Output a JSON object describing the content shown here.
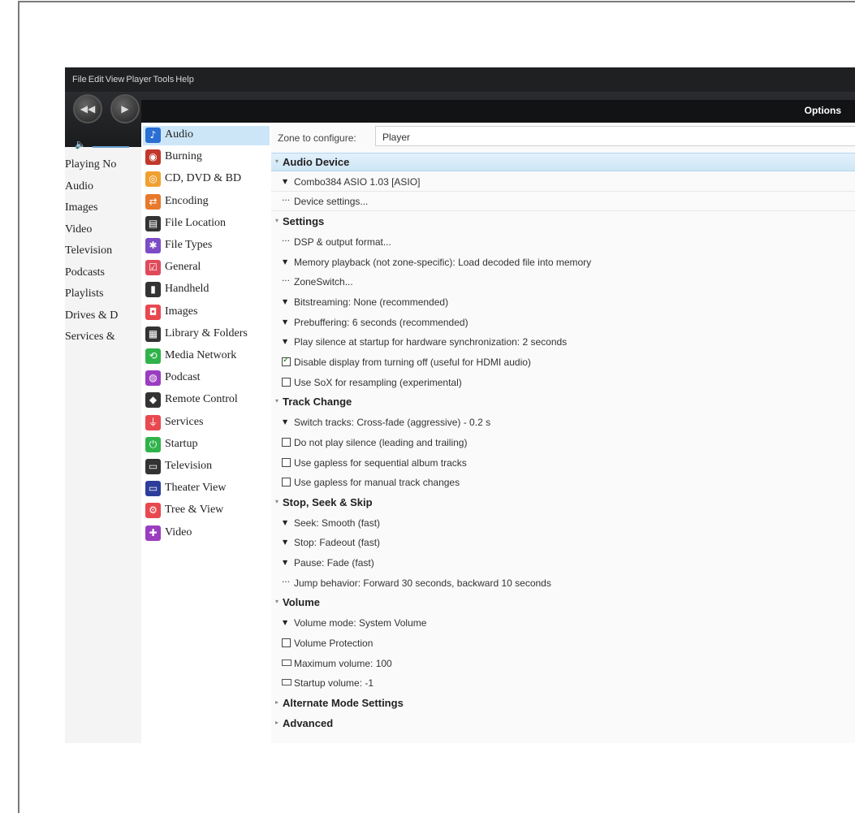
{
  "menu": [
    "File",
    "Edit",
    "View",
    "Player",
    "Tools",
    "Help"
  ],
  "left_nav": [
    "Playing No",
    "Audio",
    "Images",
    "Video",
    "Television",
    "Podcasts",
    "Playlists",
    "Drives & D",
    "Services &"
  ],
  "dialog": {
    "title": "Options",
    "zone_label": "Zone to configure:",
    "zone_value": "Player"
  },
  "categories": [
    {
      "label": "Audio",
      "icon": "music-note-icon",
      "color": "#2a6fd1",
      "selected": true
    },
    {
      "label": "Burning",
      "icon": "burn-disc-icon",
      "color": "#c0392b"
    },
    {
      "label": "CD, DVD & BD",
      "icon": "disc-icon",
      "color": "#f0a030"
    },
    {
      "label": "Encoding",
      "icon": "encoding-icon",
      "color": "#e8782a"
    },
    {
      "label": "File Location",
      "icon": "file-location-icon",
      "color": "#333333"
    },
    {
      "label": "File Types",
      "icon": "puzzle-icon",
      "color": "#7b4cc6"
    },
    {
      "label": "General",
      "icon": "general-checkbox-icon",
      "color": "#e04a5a"
    },
    {
      "label": "Handheld",
      "icon": "handheld-icon",
      "color": "#333333"
    },
    {
      "label": "Images",
      "icon": "camera-icon",
      "color": "#e8484f"
    },
    {
      "label": "Library & Folders",
      "icon": "library-icon",
      "color": "#333333"
    },
    {
      "label": "Media Network",
      "icon": "network-icon",
      "color": "#2fb34a"
    },
    {
      "label": "Podcast",
      "icon": "podcast-icon",
      "color": "#9b3dc0"
    },
    {
      "label": "Remote Control",
      "icon": "remote-icon",
      "color": "#333333"
    },
    {
      "label": "Services",
      "icon": "plug-icon",
      "color": "#e8484f"
    },
    {
      "label": "Startup",
      "icon": "power-icon",
      "color": "#2fb34a"
    },
    {
      "label": "Television",
      "icon": "tv-icon",
      "color": "#333333"
    },
    {
      "label": "Theater View",
      "icon": "monitor-icon",
      "color": "#2c3e9a"
    },
    {
      "label": "Tree & View",
      "icon": "gear-icon",
      "color": "#e8484f"
    },
    {
      "label": "Video",
      "icon": "film-icon",
      "color": "#9b3dc0"
    }
  ],
  "settings": [
    {
      "type": "section",
      "label": "Audio Device",
      "expanded": true,
      "selected": true
    },
    {
      "type": "dropdown",
      "label": "Combo384 ASIO 1.03 [ASIO]"
    },
    {
      "type": "action",
      "label": "Device settings..."
    },
    {
      "type": "section",
      "label": "Settings",
      "expanded": true
    },
    {
      "type": "action",
      "label": "DSP & output format..."
    },
    {
      "type": "dropdown",
      "label": "Memory playback (not zone-specific): Load decoded file into memory"
    },
    {
      "type": "action",
      "label": "ZoneSwitch..."
    },
    {
      "type": "dropdown",
      "label": "Bitstreaming: None (recommended)"
    },
    {
      "type": "dropdown",
      "label": "Prebuffering: 6 seconds (recommended)"
    },
    {
      "type": "dropdown",
      "label": "Play silence at startup for hardware synchronization: 2 seconds"
    },
    {
      "type": "checkbox",
      "label": "Disable display from turning off (useful for HDMI audio)",
      "checked": true
    },
    {
      "type": "checkbox",
      "label": "Use SoX for resampling (experimental)",
      "checked": false
    },
    {
      "type": "section",
      "label": "Track Change",
      "expanded": true
    },
    {
      "type": "dropdown",
      "label": "Switch tracks: Cross-fade (aggressive) - 0.2 s"
    },
    {
      "type": "checkbox",
      "label": "Do not play silence (leading and trailing)",
      "checked": false
    },
    {
      "type": "checkbox",
      "label": "Use gapless for sequential album tracks",
      "checked": false
    },
    {
      "type": "checkbox",
      "label": "Use gapless for manual track changes",
      "checked": false
    },
    {
      "type": "section",
      "label": "Stop, Seek & Skip",
      "expanded": true
    },
    {
      "type": "dropdown",
      "label": "Seek: Smooth (fast)"
    },
    {
      "type": "dropdown",
      "label": "Stop: Fadeout (fast)"
    },
    {
      "type": "dropdown",
      "label": "Pause: Fade (fast)"
    },
    {
      "type": "action",
      "label": "Jump behavior: Forward 30 seconds, backward 10 seconds"
    },
    {
      "type": "section",
      "label": "Volume",
      "expanded": true
    },
    {
      "type": "dropdown",
      "label": "Volume mode: System Volume"
    },
    {
      "type": "checkbox",
      "label": "Volume Protection",
      "checked": false
    },
    {
      "type": "edit",
      "label": "Maximum volume: 100"
    },
    {
      "type": "edit",
      "label": "Startup volume: -1"
    },
    {
      "type": "section",
      "label": "Alternate Mode Settings",
      "expanded": false
    },
    {
      "type": "section",
      "label": "Advanced",
      "expanded": false
    }
  ]
}
